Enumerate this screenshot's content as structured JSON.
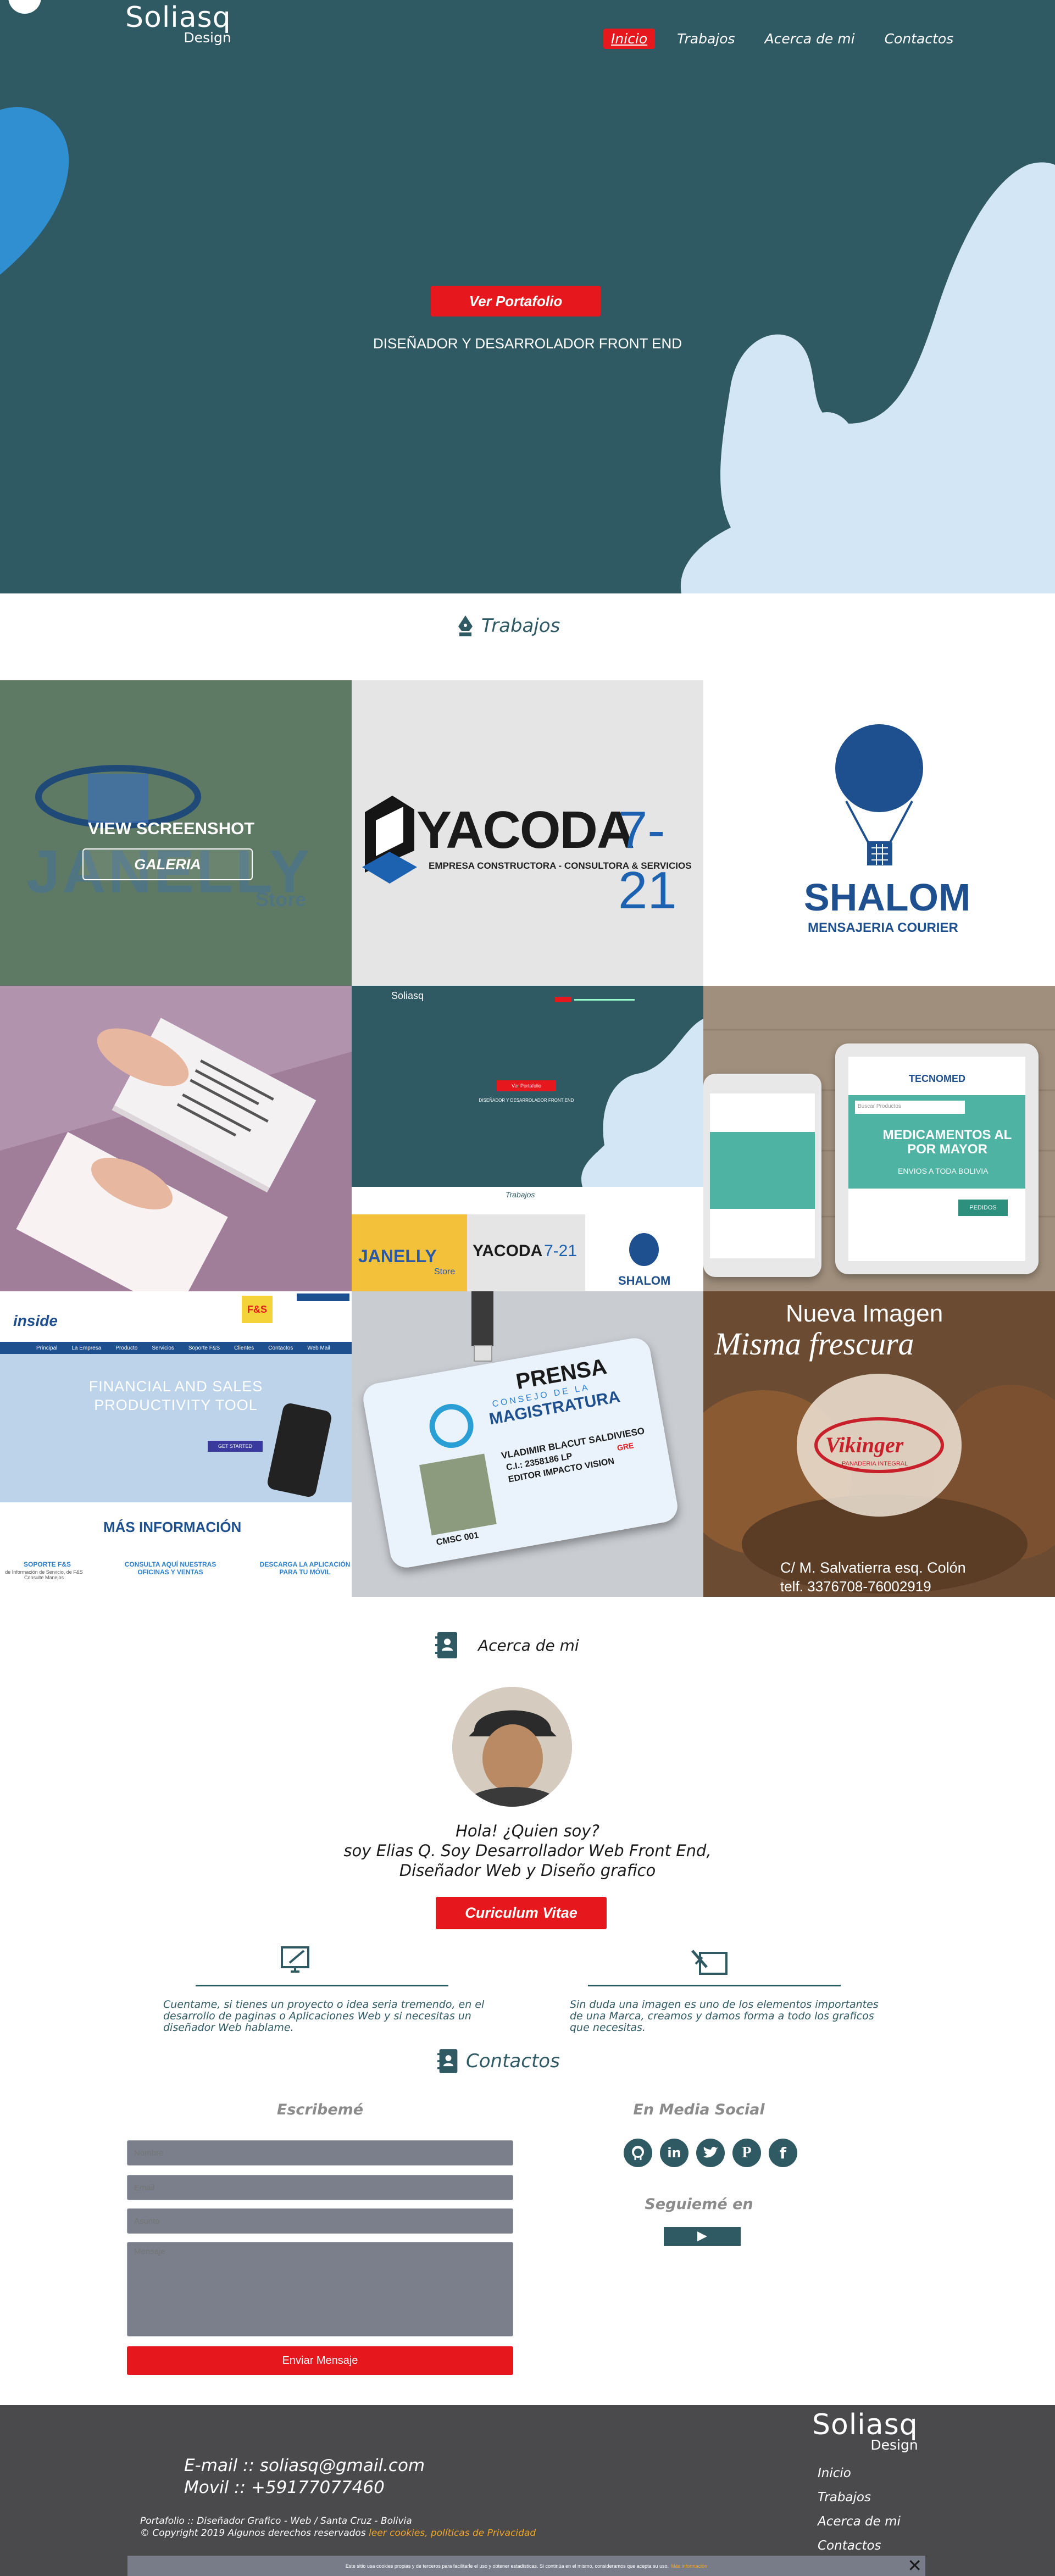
{
  "header": {
    "logo_main": "Soliasq",
    "logo_sub": "Design",
    "nav": [
      "Inicio",
      "Trabajos",
      "Acerca de mi",
      "Contactos"
    ]
  },
  "hero": {
    "cta_label": "Ver Portafolio",
    "subtitle": "DISEÑADOR Y DESARROLADOR FRONT END"
  },
  "works": {
    "title": "Trabajos",
    "tile1": {
      "overlay_title": "VIEW SCREENSHOT",
      "overlay_button": "GALERIA",
      "logo_text": "JANELLY",
      "logo_sub": "Store"
    },
    "tile2": {
      "logo_text": "YACODA",
      "logo_num": "7-21",
      "tagline": "EMPRESA CONSTRUCTORA - CONSULTORA & SERVICIOS"
    },
    "tile3": {
      "logo_text": "SHALOM",
      "tagline": "MENSAJERIA COURIER"
    },
    "tile5": {
      "mini_logo": "Soliasq",
      "mini_cta": "Ver Portafolio",
      "mini_subtitle": "DISEÑADOR Y DESARROLADOR FRONT END",
      "mini_works": "Trabajos",
      "mini_janelly": "JANELLY",
      "mini_store": "Store",
      "mini_yacoda": "YACODA",
      "mini_yacoda_num": "7-21",
      "mini_shalom": "SHALOM"
    },
    "tile6": {
      "brand": "TECNOMED",
      "search": "Buscar Productos",
      "headline": "MEDICAMENTOS AL POR MAYOR",
      "sub": "ENVIOS A TODA BOLIVIA",
      "button": "PEDIDOS"
    },
    "tile7": {
      "brand": "inside",
      "badge": "F&S",
      "nav": [
        "Principal",
        "La Empresa",
        "Producto",
        "Servicios",
        "Soporte F&S",
        "Clientes",
        "Contactos",
        "Web Mail"
      ],
      "headline": "FINANCIAL AND SALES PRODUCTIVITY TOOL",
      "cta": "GET STARTED",
      "more": "MÁS INFORMACIÓN",
      "cols": [
        "SOPORTE F&S",
        "CONSULTA AQUÍ NUESTRAS OFICINAS Y VENTAS",
        "DESCARGA LA APLICACIÓN PARA TU MÓVIL"
      ],
      "col_sub": "de Información de Servicio, de F&S Consulte Manejos"
    },
    "tile8": {
      "prensa": "PRENSA",
      "consejo": "CONSEJO DE LA",
      "magistratura": "MAGISTRATURA",
      "name": "VLADIMIR BLACUT SALDIVIESO",
      "ci": "C.I.: 2358186 LP",
      "role": "EDITOR IMPACTO VISION",
      "gre": "GRE",
      "code": "CMSC 001"
    },
    "tile9": {
      "title1": "Nueva Imagen",
      "title2": "Misma frescura",
      "brand": "Vikinger",
      "brand_sub": "PANADERIA INTEGRAL",
      "address": "C/ M. Salvatierra esq. Colón",
      "phone": "telf. 3376708-76002919"
    }
  },
  "about": {
    "title": "Acerca de mi",
    "greeting": "Hola!  ¿Quien soy?",
    "line2": "soy Elias Q. Soy Desarrollador Web Front End,",
    "line3": "Diseñador Web y Diseño grafico",
    "cv_label": "Curiculum Vitae",
    "left_text": "Cuentame, si tienes un proyecto o idea seria tremendo, en el desarrollo de paginas o Aplicaciones Web  y si necesitas un diseñador Web hablame.",
    "right_text": "Sin duda una imagen es uno de los elementos importantes de una Marca, creamos y damos forma a todo los graficos que necesitas."
  },
  "contact": {
    "title": "Contactos",
    "form_title": "Escribemé",
    "placeholders": [
      "Nombre",
      "Email",
      "Asunto",
      "Mensaje"
    ],
    "submit": "Enviar Mensaje",
    "social_title": "En Media Social",
    "follow_title": "Seguiemé en"
  },
  "footer": {
    "email": "E-mail :: soliasq@gmail.com",
    "phone": "Movil :: +59177077460",
    "logo_main": "Soliasq",
    "logo_sub": "Design",
    "links": [
      "Inicio",
      "Trabajos",
      "Acerca de mi",
      "Contactos"
    ],
    "credit": "Portafolio :: Diseñador Grafico - Web / Santa Cruz - Bolivia",
    "copyright": "© Copyright 2019 Algunos derechos reservados ",
    "cookies_link": "leer cookies, políticas de Privacidad",
    "cookie_notice": "Este sitio usa cookies propias y de terceros para facilitarle el uso y obtener estadísticas. Si continúa en el mismo, consideramos que acepta su uso. ",
    "cookie_more": "Más información"
  },
  "colors": {
    "primary": "#2f5963",
    "accent": "#e6181d",
    "light_blob": "#d3e6f6",
    "footer": "#4a4a4c"
  }
}
